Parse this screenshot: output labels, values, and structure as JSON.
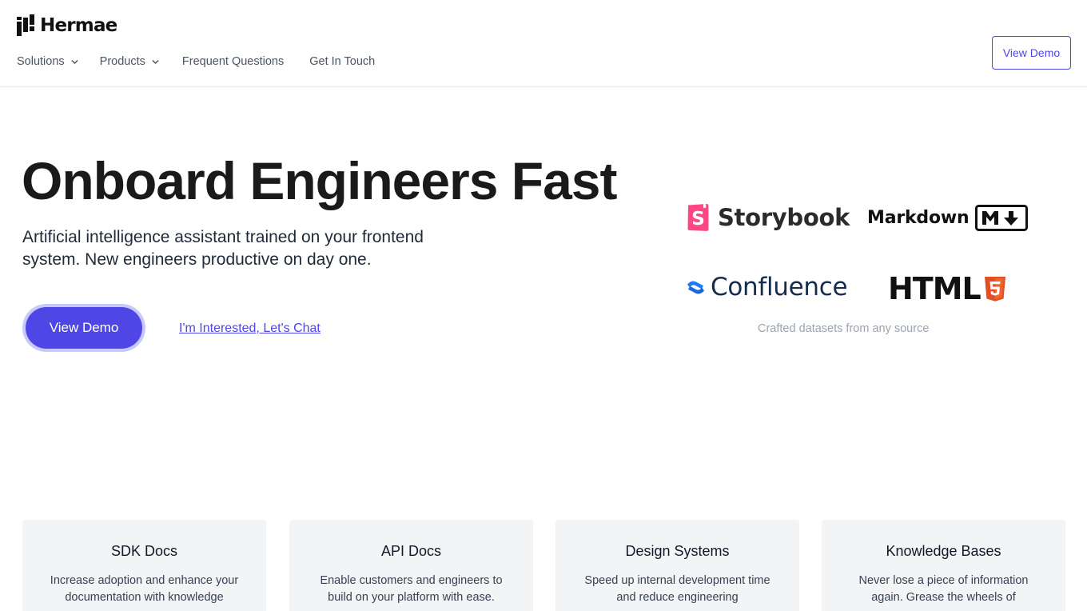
{
  "brand": {
    "name": "Hermae",
    "accent": "#4f46e5"
  },
  "nav": {
    "items": [
      {
        "label": "Solutions",
        "has_dropdown": true
      },
      {
        "label": "Products",
        "has_dropdown": true
      },
      {
        "label": "Frequent Questions",
        "has_dropdown": false
      },
      {
        "label": "Get In Touch",
        "has_dropdown": false
      }
    ],
    "cta_label": "View Demo"
  },
  "hero": {
    "title": "Onboard Engineers Fast",
    "subtitle": "Artificial intelligence assistant trained on your frontend system. New engineers productive on day one.",
    "primary_cta": "View Demo",
    "secondary_cta": "I'm Interested, Let's Chat"
  },
  "sources": {
    "logos": [
      {
        "name": "Storybook",
        "icon": "storybook-icon"
      },
      {
        "name": "Markdown",
        "icon": "markdown-icon"
      },
      {
        "name": "Confluence",
        "icon": "confluence-icon"
      },
      {
        "name": "HTML",
        "icon": "html5-icon"
      }
    ],
    "caption": "Crafted datasets from any source"
  },
  "features": [
    {
      "title": "SDK Docs",
      "description": "Increase adoption and enhance your documentation with knowledge"
    },
    {
      "title": "API Docs",
      "description": "Enable customers and engineers to build on your platform with ease."
    },
    {
      "title": "Design Systems",
      "description": "Speed up internal development time and reduce engineering"
    },
    {
      "title": "Knowledge Bases",
      "description": "Never lose a piece of information again. Grease the wheels of"
    }
  ]
}
